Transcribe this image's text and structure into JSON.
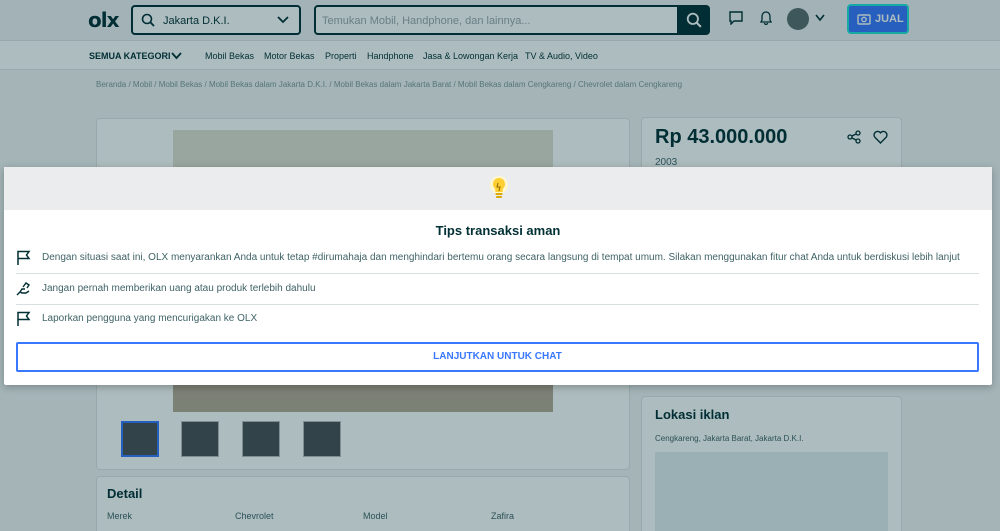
{
  "header": {
    "logo": "olx",
    "location": "Jakarta D.K.I.",
    "search_placeholder": "Temukan Mobil, Handphone, dan lainnya...",
    "sell_label": "JUAL"
  },
  "categories": {
    "all_label": "SEMUA KATEGORI",
    "items": [
      "Mobil Bekas",
      "Motor Bekas",
      "Properti",
      "Handphone",
      "Jasa & Lowongan Kerja",
      "TV & Audio, Video"
    ]
  },
  "breadcrumb": "Beranda / Mobil / Mobil Bekas / Mobil Bekas dalam Jakarta D.K.I. / Mobil Bekas dalam Jakarta Barat / Mobil Bekas dalam Cengkareng / Chevrolet dalam Cengkareng",
  "listing": {
    "price": "Rp 43.000.000",
    "year": "2003",
    "location_title": "Lokasi iklan",
    "location_address": "Cengkareng, Jakarta Barat, Jakarta D.K.I.",
    "detail_title": "Detail",
    "detail_labels": [
      "Merek",
      "Chevrolet",
      "Model",
      "Zafira"
    ]
  },
  "modal": {
    "title": "Tips transaksi aman",
    "tips": [
      {
        "icon": "flag-icon",
        "text": "Dengan situasi saat ini, OLX menyarankan Anda untuk tetap #dirumahaja dan menghindari bertemu orang secara langsung di tempat umum. Silakan menggunakan fitur chat Anda untuk berdiskusi lebih lanjut"
      },
      {
        "icon": "hand-money-icon",
        "text": "Jangan pernah memberikan uang atau produk terlebih dahulu"
      },
      {
        "icon": "flag-icon",
        "text": "Laporkan pengguna yang mencurigakan ke OLX"
      }
    ],
    "cta_label": "LANJUTKAN UNTUK CHAT"
  },
  "colors": {
    "brand": "#002f34",
    "accent": "#3a77ff",
    "bulb": "#ffce32"
  }
}
